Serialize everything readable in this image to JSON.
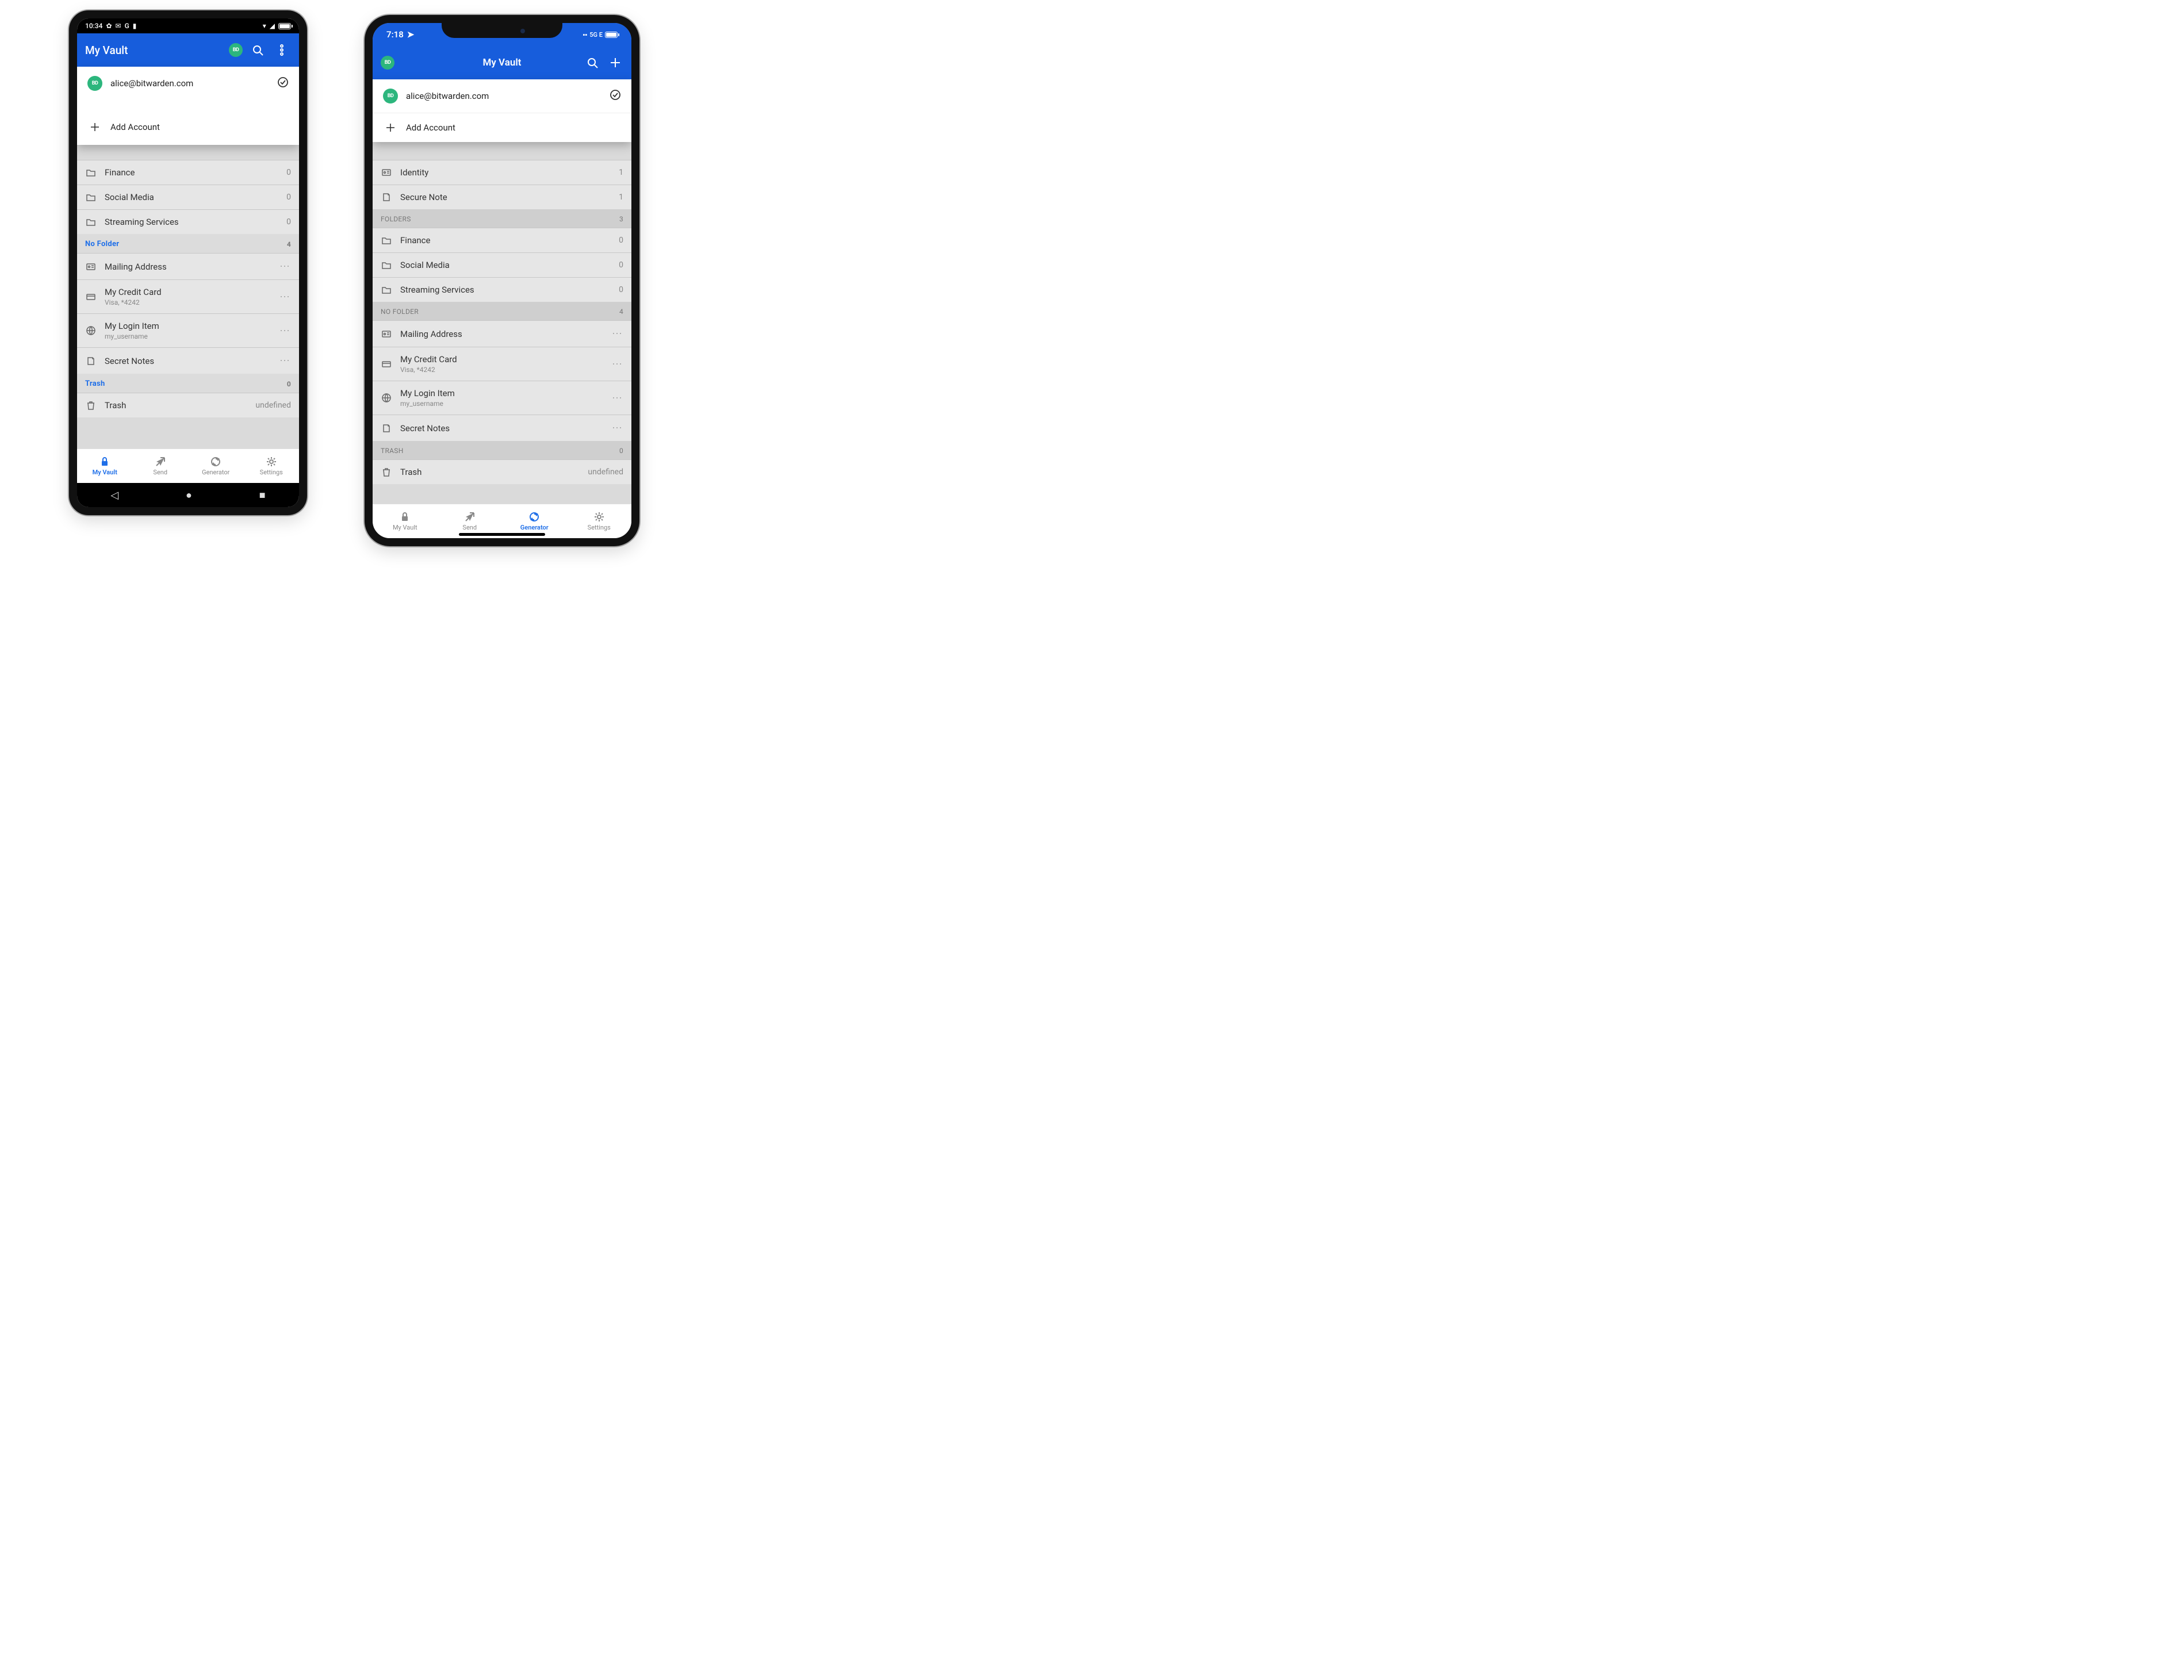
{
  "common": {
    "app_title": "My Vault",
    "avatar_initials": "BD",
    "account_email": "alice@bitwarden.com",
    "add_account_label": "Add Account"
  },
  "android": {
    "status": {
      "time": "10:34"
    },
    "folders_partial": [
      {
        "label": "Finance",
        "count": 0
      },
      {
        "label": "Social Media",
        "count": 0
      },
      {
        "label": "Streaming Services",
        "count": 0
      }
    ],
    "no_folder": {
      "heading": "No Folder",
      "count": 4,
      "items": [
        {
          "type": "identity",
          "label": "Mailing Address"
        },
        {
          "type": "card",
          "label": "My Credit Card",
          "sub": "Visa, *4242"
        },
        {
          "type": "login",
          "label": "My Login Item",
          "sub": "my_username"
        },
        {
          "type": "note",
          "label": "Secret Notes"
        }
      ]
    },
    "trash": {
      "heading": "Trash",
      "count": 0,
      "row_label": "Trash"
    },
    "tabs": [
      {
        "label": "My Vault",
        "active": true
      },
      {
        "label": "Send"
      },
      {
        "label": "Generator"
      },
      {
        "label": "Settings"
      }
    ]
  },
  "ios": {
    "status": {
      "time": "7:18",
      "net": "5G E"
    },
    "types_partial": [
      {
        "label": "Identity",
        "count": 1
      },
      {
        "label": "Secure Note",
        "count": 1
      }
    ],
    "folders": {
      "heading": "FOLDERS",
      "count": 3,
      "items": [
        {
          "label": "Finance",
          "count": 0
        },
        {
          "label": "Social Media",
          "count": 0
        },
        {
          "label": "Streaming Services",
          "count": 0
        }
      ]
    },
    "no_folder": {
      "heading": "NO FOLDER",
      "count": 4,
      "items": [
        {
          "type": "identity",
          "label": "Mailing Address"
        },
        {
          "type": "card",
          "label": "My Credit Card",
          "sub": "Visa, *4242"
        },
        {
          "type": "login",
          "label": "My Login Item",
          "sub": "my_username"
        },
        {
          "type": "note",
          "label": "Secret Notes"
        }
      ]
    },
    "trash": {
      "heading": "TRASH",
      "count": 0,
      "row_label": "Trash"
    },
    "tabs": [
      {
        "label": "My Vault"
      },
      {
        "label": "Send"
      },
      {
        "label": "Generator",
        "active": true
      },
      {
        "label": "Settings"
      }
    ]
  }
}
